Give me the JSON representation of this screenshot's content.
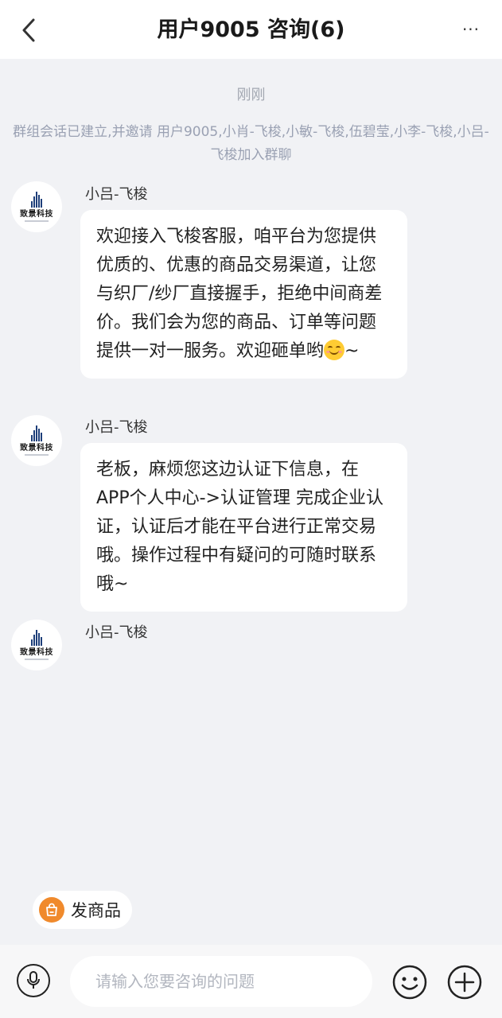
{
  "header": {
    "title": "用户9005 咨询(6)",
    "more_label": "···"
  },
  "chat": {
    "timestamp": "刚刚",
    "system_message": "群组会话已建立,并邀请 用户9005,小肖-飞梭,小敏-飞梭,伍碧莹,小李-飞梭,小吕-飞梭加入群聊",
    "avatar_brand": "致景科技",
    "messages": [
      {
        "sender": "小吕-飞梭",
        "text": "欢迎接入飞梭客服，咱平台为您提供优质的、优惠的商品交易渠道，让您与织厂/纱厂直接握手，拒绝中间商差价。我们会为您的商品、订单等问题提供一对一服务。欢迎砸单哟",
        "emoji": "smiling-face-icon",
        "suffix": "~"
      },
      {
        "sender": "小吕-飞梭",
        "text": "老板，麻烦您这边认证下信息，在APP个人中心->认证管理 完成企业认证，认证后才能在平台进行正常交易哦。操作过程中有疑问的可随时联系哦~"
      },
      {
        "sender": "小吕-飞梭"
      }
    ]
  },
  "quick_actions": {
    "post_product_label": "发商品"
  },
  "composer": {
    "placeholder": "请输入您要咨询的问题"
  },
  "colors": {
    "background": "#f1f2f5",
    "bubble": "#ffffff",
    "accent": "#f08a2c",
    "brand": "#1e3f7a"
  }
}
